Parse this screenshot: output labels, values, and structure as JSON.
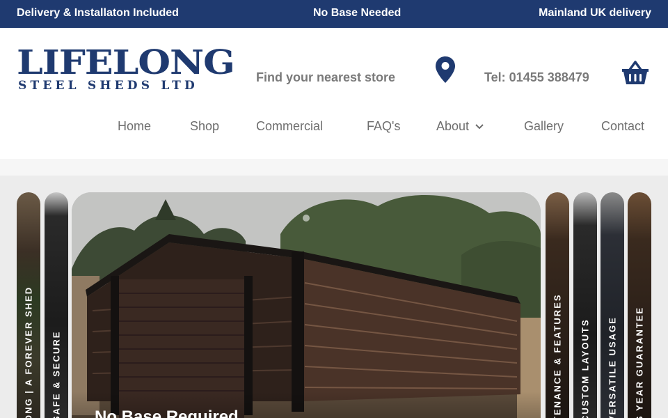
{
  "topbar": {
    "left": "Delivery & Installaton Included",
    "center": "No Base Needed",
    "right": "Mainland UK delivery"
  },
  "logo": {
    "main": "LIFELONG",
    "sub": "STEEL SHEDS LTD"
  },
  "header": {
    "store_link": "Find your nearest store",
    "telephone": "Tel: 01455 388479"
  },
  "nav": {
    "items": [
      "Home",
      "Shop",
      "Commercial",
      "FAQ's",
      "About",
      "Gallery",
      "Contact"
    ]
  },
  "slider": {
    "panels": [
      "ONG | A FOREVER SHED",
      "SAFE & SECURE",
      "TENANCE & FEATURES",
      "CUSTOM LAYOUTS",
      "VERSATILE USAGE",
      "S YEAR GUARANTEE"
    ],
    "active_title": "No Base Required"
  },
  "colors": {
    "brand": "#1f3a70",
    "nav_text": "#6e6e6e",
    "header_text": "#7a7a7a"
  },
  "icons": [
    "location-pin-icon",
    "shopping-basket-icon",
    "chevron-down-icon"
  ]
}
